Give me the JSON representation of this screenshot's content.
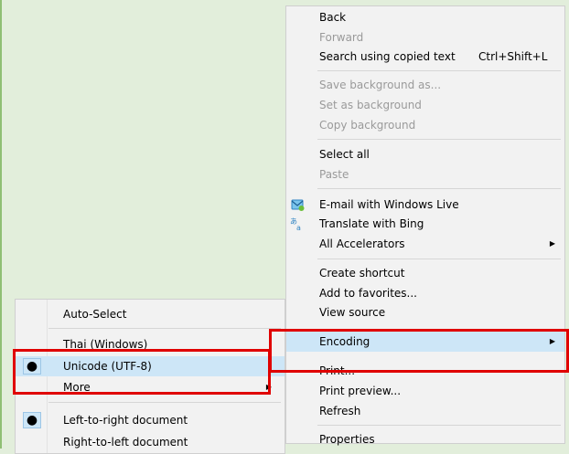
{
  "context_menu": {
    "items": [
      {
        "label": "Back"
      },
      {
        "label": "Forward"
      },
      {
        "label": "Search using copied text",
        "shortcut": "Ctrl+Shift+L"
      },
      {
        "label": "Save background as..."
      },
      {
        "label": "Set as background"
      },
      {
        "label": "Copy background"
      },
      {
        "label": "Select all"
      },
      {
        "label": "Paste"
      },
      {
        "label": "E-mail with Windows Live"
      },
      {
        "label": "Translate with Bing"
      },
      {
        "label": "All Accelerators"
      },
      {
        "label": "Create shortcut"
      },
      {
        "label": "Add to favorites..."
      },
      {
        "label": "View source"
      },
      {
        "label": "Encoding"
      },
      {
        "label": "Print..."
      },
      {
        "label": "Print preview..."
      },
      {
        "label": "Refresh"
      },
      {
        "label": "Properties"
      }
    ]
  },
  "encoding_submenu": {
    "items": [
      {
        "label": "Auto-Select"
      },
      {
        "label": "Thai (Windows)"
      },
      {
        "label": "Unicode (UTF-8)"
      },
      {
        "label": "More"
      },
      {
        "label": "Left-to-right document"
      },
      {
        "label": "Right-to-left document"
      }
    ]
  },
  "icons": {
    "email": "email-live-icon",
    "translate": "translate-bing-icon",
    "submenu_arrow": "submenu-arrow-icon",
    "bullet": "radio-bullet-icon"
  },
  "colors": {
    "highlight": "#cde6f7",
    "annotation_red": "#e00000",
    "background": "#e2eedb"
  }
}
